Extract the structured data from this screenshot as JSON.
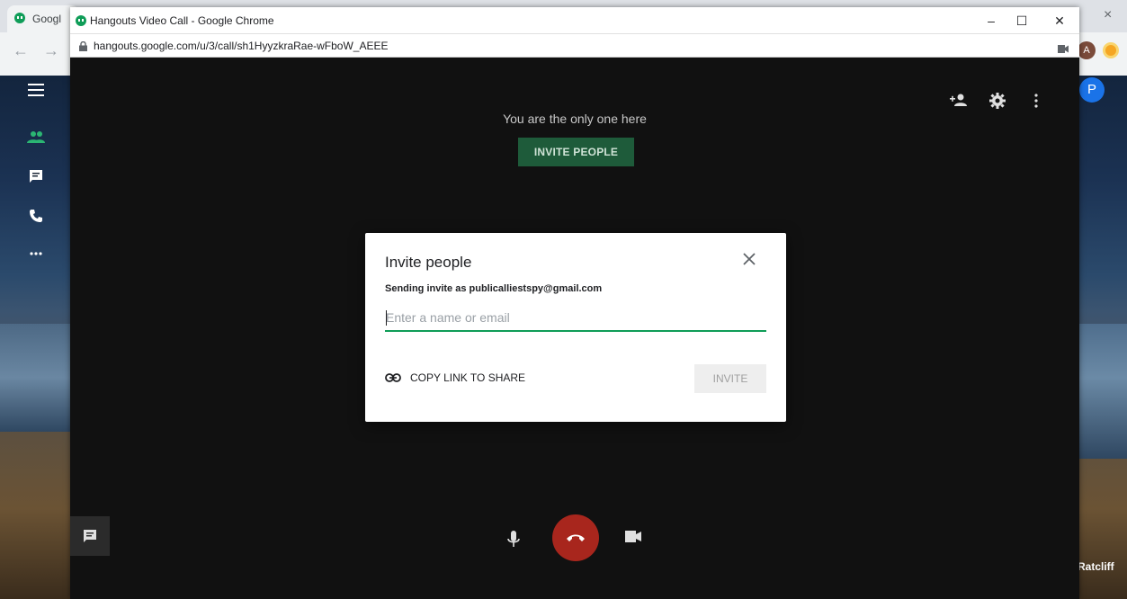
{
  "background_browser": {
    "tab_title": "Googl",
    "close_glyph": "×",
    "back_glyph": "←",
    "forward_glyph": "→",
    "avatar_letter": "A",
    "right_avatar_letter": "P",
    "right_name": "Ratcliff"
  },
  "popup": {
    "title": "Hangouts Video Call - Google Chrome",
    "url": "hangouts.google.com/u/3/call/sh1HyyzkraRae-wFboW_AEEE",
    "minimize_glyph": "–",
    "maximize_glyph": "☐",
    "close_glyph": "✕"
  },
  "call": {
    "status_text": "You are the only one here",
    "invite_people_label": "INVITE PEOPLE"
  },
  "dialog": {
    "title": "Invite people",
    "sender_text": "Sending invite as publicalliestspy@gmail.com",
    "input_placeholder": "Enter a name or email",
    "copy_link_label": "COPY LINK TO SHARE",
    "invite_label": "INVITE"
  },
  "colors": {
    "hangouts_green": "#0f9d58",
    "hangup_red": "#a8261d",
    "invite_people_bg": "#1e5b3a"
  }
}
